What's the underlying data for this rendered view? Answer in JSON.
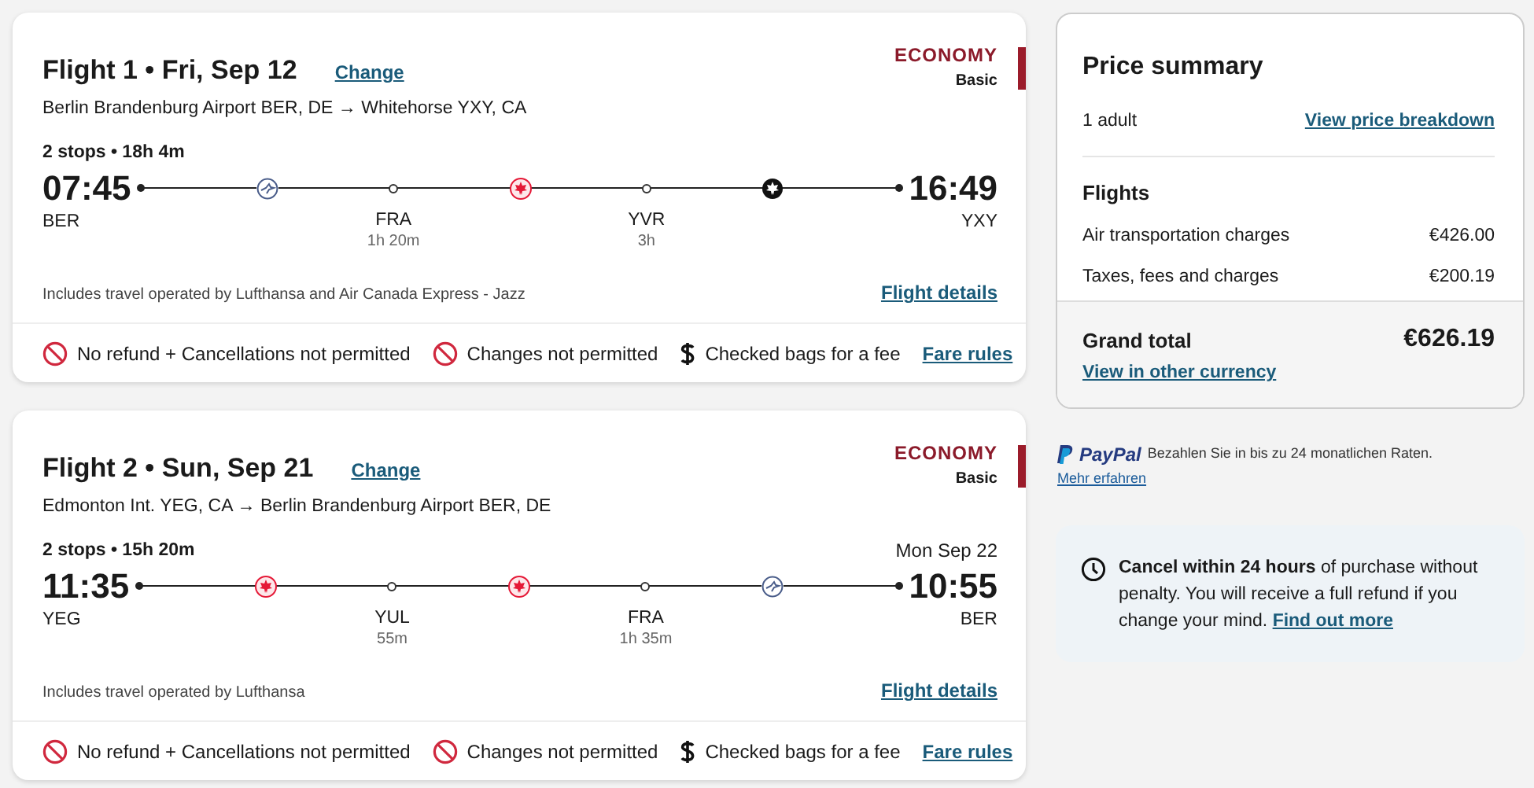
{
  "flights": [
    {
      "title": "Flight 1 • Fri, Sep 12",
      "change": "Change",
      "cabin": "ECONOMY",
      "fare": "Basic",
      "route": "Berlin Brandenburg Airport BER, DE → Whitehorse YXY, CA",
      "summary": "2 stops • 18h 4m",
      "depart_time": "07:45",
      "depart_code": "BER",
      "arrive_time": "16:49",
      "arrive_code": "YXY",
      "timeline": [
        {
          "kind": "crane"
        },
        {
          "kind": "stop",
          "code": "FRA",
          "layover": "1h 20m"
        },
        {
          "kind": "leaf"
        },
        {
          "kind": "stop",
          "code": "YVR",
          "layover": "3h"
        },
        {
          "kind": "leaf-dark"
        }
      ],
      "operated": "Includes travel operated by Lufthansa and Air Canada Express - Jazz",
      "details": "Flight details",
      "conditions": [
        {
          "kind": "no",
          "text": "No refund + Cancellations not permitted"
        },
        {
          "kind": "no",
          "text": "Changes not permitted"
        },
        {
          "kind": "fee",
          "text": "Checked bags for a fee"
        }
      ],
      "fare_rules": "Fare rules"
    },
    {
      "title": "Flight 2 • Sun, Sep 21",
      "change": "Change",
      "cabin": "ECONOMY",
      "fare": "Basic",
      "route": "Edmonton Int. YEG, CA → Berlin Brandenburg Airport BER, DE",
      "summary": "2 stops • 15h 20m",
      "arrival_date": "Mon Sep 22",
      "depart_time": "11:35",
      "depart_code": "YEG",
      "arrive_time": "10:55",
      "arrive_code": "BER",
      "timeline": [
        {
          "kind": "leaf"
        },
        {
          "kind": "stop",
          "code": "YUL",
          "layover": "55m"
        },
        {
          "kind": "leaf"
        },
        {
          "kind": "stop",
          "code": "FRA",
          "layover": "1h 35m"
        },
        {
          "kind": "crane"
        }
      ],
      "operated": "Includes travel operated by Lufthansa",
      "details": "Flight details",
      "conditions": [
        {
          "kind": "no",
          "text": "No refund + Cancellations not permitted"
        },
        {
          "kind": "no",
          "text": "Changes not permitted"
        },
        {
          "kind": "fee",
          "text": "Checked bags for a fee"
        }
      ],
      "fare_rules": "Fare rules"
    }
  ],
  "price_summary": {
    "title": "Price summary",
    "passengers": "1 adult",
    "breakdown_link": "View price breakdown",
    "section": "Flights",
    "lines": [
      {
        "label": "Air transportation charges",
        "amount": "€426.00"
      },
      {
        "label": "Taxes, fees and charges",
        "amount": "€200.19"
      }
    ],
    "total_label": "Grand total",
    "total": "€626.19",
    "currency_link": "View in other currency"
  },
  "paypal": {
    "logo": "PayPal",
    "text": "Bezahlen Sie in bis zu 24 monatlichen Raten.",
    "link": "Mehr erfahren"
  },
  "cancel_note": {
    "text": "**Cancel within 24 hours** of purchase without penalty. You will receive a full refund if you change your mind.",
    "link": "Find out more"
  }
}
